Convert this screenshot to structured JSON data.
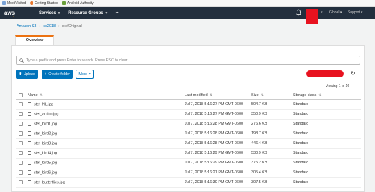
{
  "bookmarks": [
    {
      "label": "Most Visited",
      "icon": "star-icon"
    },
    {
      "label": "Getting Started",
      "icon": "firefox-icon"
    },
    {
      "label": "Android Authority",
      "icon": "android-icon"
    }
  ],
  "nav": {
    "logo": "aws",
    "services": "Services",
    "resource_groups": "Resource Groups",
    "global": "Global",
    "support": "Support"
  },
  "breadcrumb": {
    "root": "Amazon S3",
    "bucket": "cc2018",
    "folder": "stefOriginal"
  },
  "tabs": {
    "overview": "Overview"
  },
  "search": {
    "placeholder": "Type a prefix and press Enter to search. Press ESC to clear."
  },
  "toolbar": {
    "upload": "Upload",
    "create_folder": "Create folder",
    "more": "More"
  },
  "viewing": "Viewing 1 to 16",
  "table": {
    "headers": {
      "name": "Name",
      "last_modified": "Last modified",
      "size": "Size",
      "storage_class": "Storage class"
    },
    "rows": [
      {
        "name": "stef_NL.jpg",
        "modified": "Jul 7, 2018 5:16:27 PM GMT-0600",
        "size": "504.7 KB",
        "storage": "Standard"
      },
      {
        "name": "stef_action.jpg",
        "modified": "Jul 7, 2018 5:16:27 PM GMT-0600",
        "size": "350.9 KB",
        "storage": "Standard"
      },
      {
        "name": "stef_bird1.jpg",
        "modified": "Jul 7, 2018 5:16:28 PM GMT-0600",
        "size": "276.6 KB",
        "storage": "Standard"
      },
      {
        "name": "stef_bird2.jpg",
        "modified": "Jul 7, 2018 5:16:28 PM GMT-0600",
        "size": "198.7 KB",
        "storage": "Standard"
      },
      {
        "name": "stef_bird3.jpg",
        "modified": "Jul 7, 2018 5:16:28 PM GMT-0600",
        "size": "446.4 KB",
        "storage": "Standard"
      },
      {
        "name": "stef_bird4.jpg",
        "modified": "Jul 7, 2018 5:16:29 PM GMT-0600",
        "size": "530.9 KB",
        "storage": "Standard"
      },
      {
        "name": "stef_bird5.jpg",
        "modified": "Jul 7, 2018 5:16:29 PM GMT-0600",
        "size": "375.2 KB",
        "storage": "Standard"
      },
      {
        "name": "stef_bird6.jpg",
        "modified": "Jul 7, 2018 5:16:21 PM GMT-0600",
        "size": "305.4 KB",
        "storage": "Standard"
      },
      {
        "name": "stef_butterflies.jpg",
        "modified": "Jul 7, 2018 5:16:30 PM GMT-0600",
        "size": "307.5 KB",
        "storage": "Standard"
      }
    ]
  },
  "colors": {
    "nav_bg": "#232f3e",
    "accent": "#ec7211",
    "primary": "#0073bb",
    "redaction": "#e8121f"
  }
}
